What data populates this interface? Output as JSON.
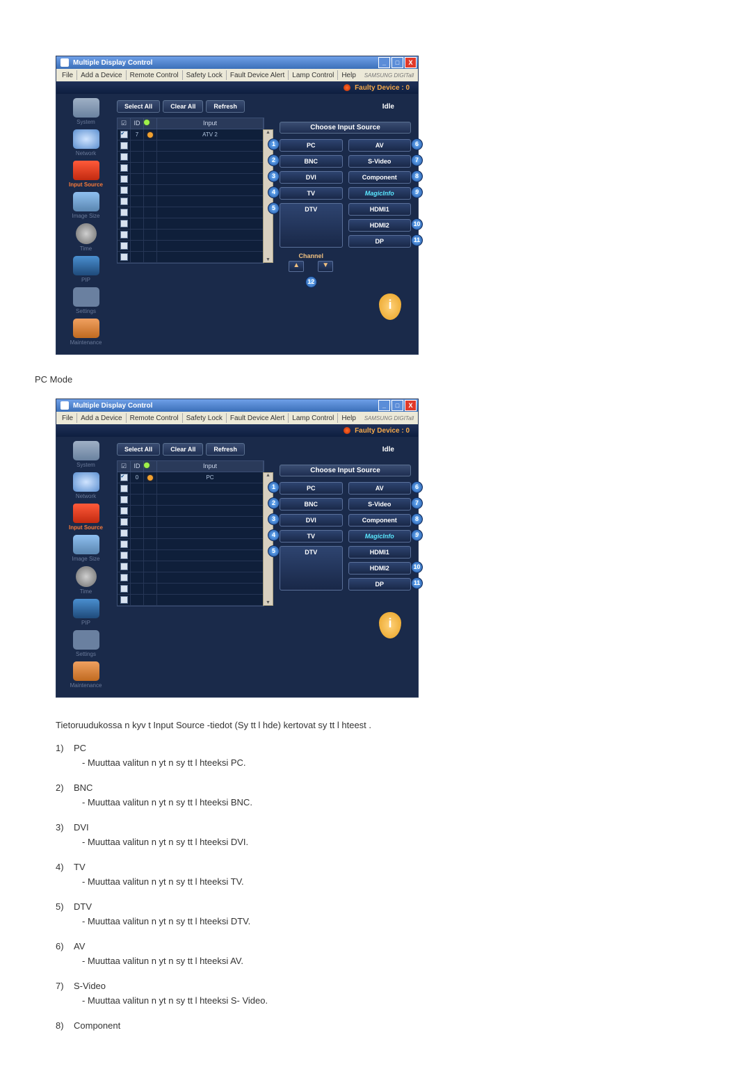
{
  "window_title": "Multiple Display Control",
  "menu": {
    "file": "File",
    "add_device": "Add a Device",
    "remote_control": "Remote Control",
    "safety_lock": "Safety Lock",
    "fault_alert": "Fault Device Alert",
    "lamp": "Lamp Control",
    "help": "Help",
    "brand": "SAMSUNG DIGITall"
  },
  "faulty_device": "Faulty Device : 0",
  "buttons": {
    "select_all": "Select All",
    "clear_all": "Clear All",
    "refresh": "Refresh",
    "idle": "Idle"
  },
  "sidebar": [
    {
      "key": "system",
      "label": "System"
    },
    {
      "key": "network",
      "label": "Network"
    },
    {
      "key": "input",
      "label": "Input Source"
    },
    {
      "key": "image_size",
      "label": "Image Size"
    },
    {
      "key": "time",
      "label": "Time"
    },
    {
      "key": "pip",
      "label": "PIP"
    },
    {
      "key": "settings",
      "label": "Settings"
    },
    {
      "key": "maintenance",
      "label": "Maintenance"
    }
  ],
  "list_columns": {
    "chk": "☑",
    "id": "ID",
    "status": " ",
    "input": "Input"
  },
  "list1_row": {
    "id": "7",
    "input": "ATV 2"
  },
  "list2_row": {
    "id": "0",
    "input": "PC"
  },
  "source_panel": {
    "heading": "Choose Input Source",
    "pc": "PC",
    "bnc": "BNC",
    "dvi": "DVI",
    "tv": "TV",
    "dtv": "DTV",
    "av": "AV",
    "svideo": "S-Video",
    "component": "Component",
    "magicinfo": "MagicInfo",
    "hdmi1": "HDMI1",
    "hdmi2": "HDMI2",
    "dp": "DP",
    "channel": "Channel"
  },
  "callouts": {
    "c1": "1",
    "c2": "2",
    "c3": "3",
    "c4": "4",
    "c5": "5",
    "c6": "6",
    "c7": "7",
    "c8": "8",
    "c9": "9",
    "c10": "10",
    "c11": "11",
    "c12": "12"
  },
  "text": {
    "pc_mode": "PC Mode",
    "intro": "Tietoruudukossa n kyv t Input Source -tiedot (Sy tt l hde) kertovat sy tt l hteest .",
    "items": [
      {
        "term": "PC",
        "sub": "- Muuttaa valitun n yt n sy tt l hteeksi PC."
      },
      {
        "term": "BNC",
        "sub": "- Muuttaa valitun n yt n sy tt l hteeksi BNC."
      },
      {
        "term": "DVI",
        "sub": "- Muuttaa valitun n yt n sy tt l hteeksi DVI."
      },
      {
        "term": "TV",
        "sub": "- Muuttaa valitun n yt n sy tt l hteeksi TV."
      },
      {
        "term": "DTV",
        "sub": "- Muuttaa valitun n yt n sy tt l hteeksi DTV."
      },
      {
        "term": "AV",
        "sub": "- Muuttaa valitun n yt n sy tt l hteeksi AV."
      },
      {
        "term": "S-Video",
        "sub": "- Muuttaa valitun n yt n sy tt l hteeksi S-     Video."
      },
      {
        "term": "Component",
        "sub": ""
      }
    ]
  }
}
